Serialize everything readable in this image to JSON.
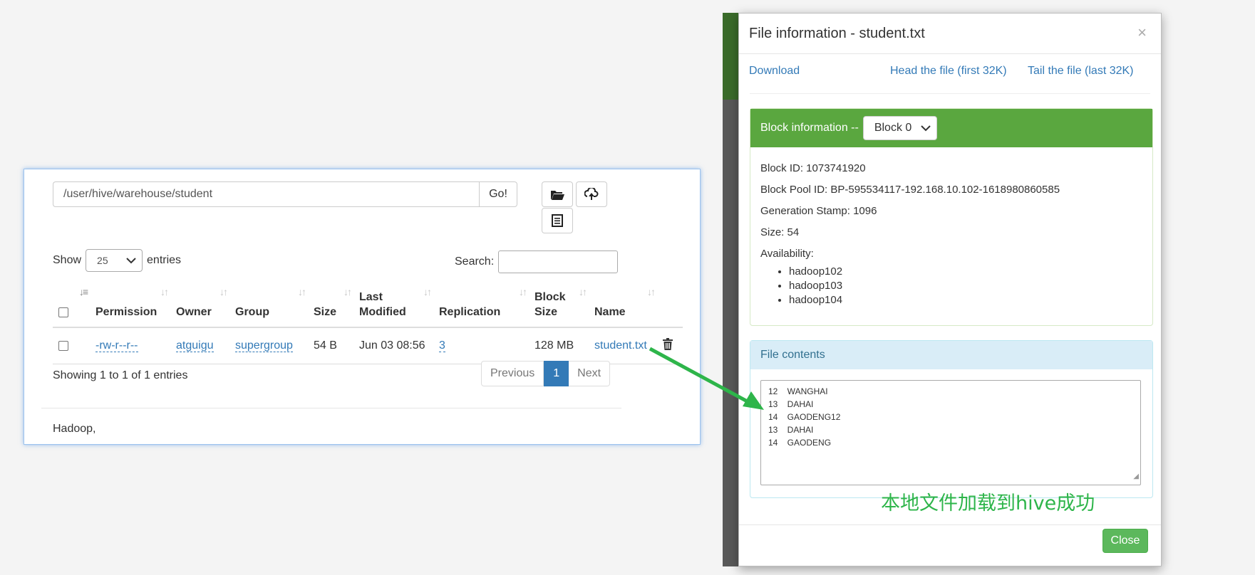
{
  "browser": {
    "path_value": "/user/hive/warehouse/student",
    "go_label": "Go!",
    "tool_icons": [
      "folder-open-icon",
      "upload-icon",
      "clipboard-icon"
    ],
    "show_label": "Show",
    "entries_value": "25",
    "entries_label": "entries",
    "search_label": "Search:",
    "columns": [
      "Permission",
      "Owner",
      "Group",
      "Size",
      "Last Modified",
      "Replication",
      "Block Size",
      "Name"
    ],
    "row": {
      "permission": "-rw-r--r--",
      "owner": "atguigu",
      "group": "supergroup",
      "size": "54 B",
      "last_modified": "Jun 03 08:56",
      "replication": "3",
      "block_size": "128 MB",
      "name": "student.txt"
    },
    "info": "Showing 1 to 1 of 1 entries",
    "pagination": {
      "previous": "Previous",
      "current": "1",
      "next": "Next"
    },
    "footer": "Hadoop,"
  },
  "modal": {
    "title": "File information - student.txt",
    "close_x": "×",
    "links": {
      "download": "Download",
      "head": "Head the file (first 32K)",
      "tail": "Tail the file (last 32K)"
    },
    "block": {
      "heading": "Block information --",
      "selected_block": "Block 0",
      "block_id": "Block ID: 1073741920",
      "pool_id": "Block Pool ID: BP-595534117-192.168.10.102-1618980860585",
      "gen_stamp": "Generation Stamp: 1096",
      "size": "Size: 54",
      "availability": "Availability:",
      "hosts": [
        "hadoop102",
        "hadoop103",
        "hadoop104"
      ]
    },
    "file_contents": {
      "heading": "File contents",
      "lines": [
        "12    WANGHAI",
        "13    DAHAI",
        "14    GAODENG12",
        "13    DAHAI",
        "14    GAODENG"
      ]
    },
    "close_button": "Close"
  },
  "annotation": {
    "text": "本地文件加载到hive成功",
    "color": "#2eb54a"
  },
  "colors": {
    "link": "#337ab7",
    "panel_green": "#5aa73f",
    "button_green": "#5cb85c",
    "page_active": "#337ab7"
  }
}
